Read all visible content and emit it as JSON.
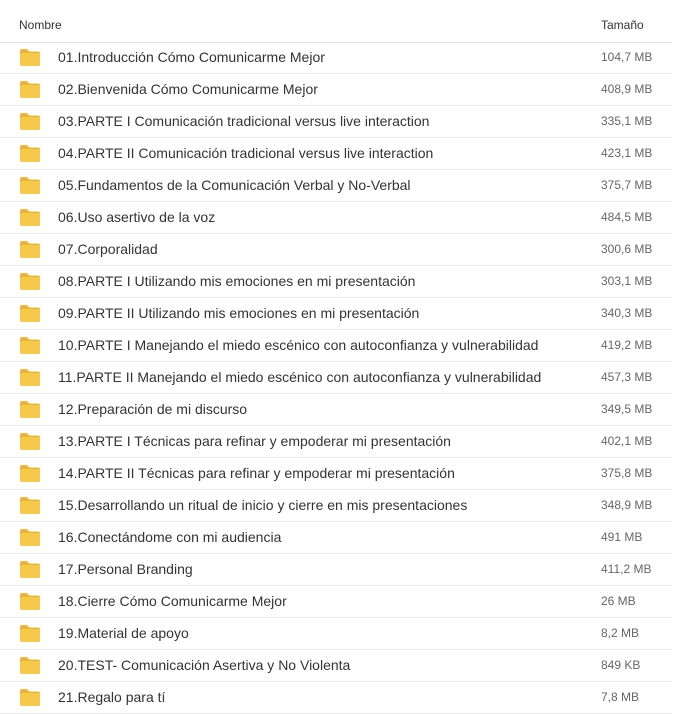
{
  "header": {
    "name_label": "Nombre",
    "size_label": "Tamaño"
  },
  "folder_color": "#f7c94a",
  "folder_tab_color": "#eab53a",
  "icons": {
    "row_icon": "folder-icon"
  },
  "items": [
    {
      "name": "01.Introducción Cómo Comunicarme Mejor",
      "size": "104,7 MB"
    },
    {
      "name": "02.Bienvenida Cómo Comunicarme Mejor",
      "size": "408,9 MB"
    },
    {
      "name": "03.PARTE I Comunicación tradicional versus live interaction",
      "size": "335,1 MB"
    },
    {
      "name": "04.PARTE II Comunicación tradicional versus live interaction",
      "size": "423,1 MB"
    },
    {
      "name": "05.Fundamentos de la Comunicación Verbal y No-Verbal",
      "size": "375,7 MB"
    },
    {
      "name": "06.Uso asertivo de la voz",
      "size": "484,5 MB"
    },
    {
      "name": "07.Corporalidad",
      "size": "300,6 MB"
    },
    {
      "name": "08.PARTE I Utilizando mis emociones en mi presentación",
      "size": "303,1 MB"
    },
    {
      "name": "09.PARTE II Utilizando mis emociones en mi presentación",
      "size": "340,3 MB"
    },
    {
      "name": "10.PARTE I Manejando el miedo escénico con autoconfianza y vulnerabilidad",
      "size": "419,2 MB"
    },
    {
      "name": "11.PARTE II Manejando el miedo escénico con autoconfianza y vulnerabilidad",
      "size": "457,3 MB"
    },
    {
      "name": "12.Preparación de mi discurso",
      "size": "349,5 MB"
    },
    {
      "name": "13.PARTE I Técnicas para refinar y empoderar mi presentación",
      "size": "402,1 MB"
    },
    {
      "name": "14.PARTE II Técnicas para refinar y empoderar mi presentación",
      "size": "375,8 MB"
    },
    {
      "name": "15.Desarrollando un ritual de inicio y cierre en mis presentaciones",
      "size": "348,9 MB"
    },
    {
      "name": "16.Conectándome con mi audiencia",
      "size": "491 MB"
    },
    {
      "name": "17.Personal Branding",
      "size": "411,2 MB"
    },
    {
      "name": "18.Cierre Cómo Comunicarme Mejor",
      "size": "26 MB"
    },
    {
      "name": "19.Material de apoyo",
      "size": "8,2 MB"
    },
    {
      "name": "20.TEST- Comunicación Asertiva y No Violenta",
      "size": "849 KB"
    },
    {
      "name": "21.Regalo para tí",
      "size": "7,8 MB"
    }
  ]
}
